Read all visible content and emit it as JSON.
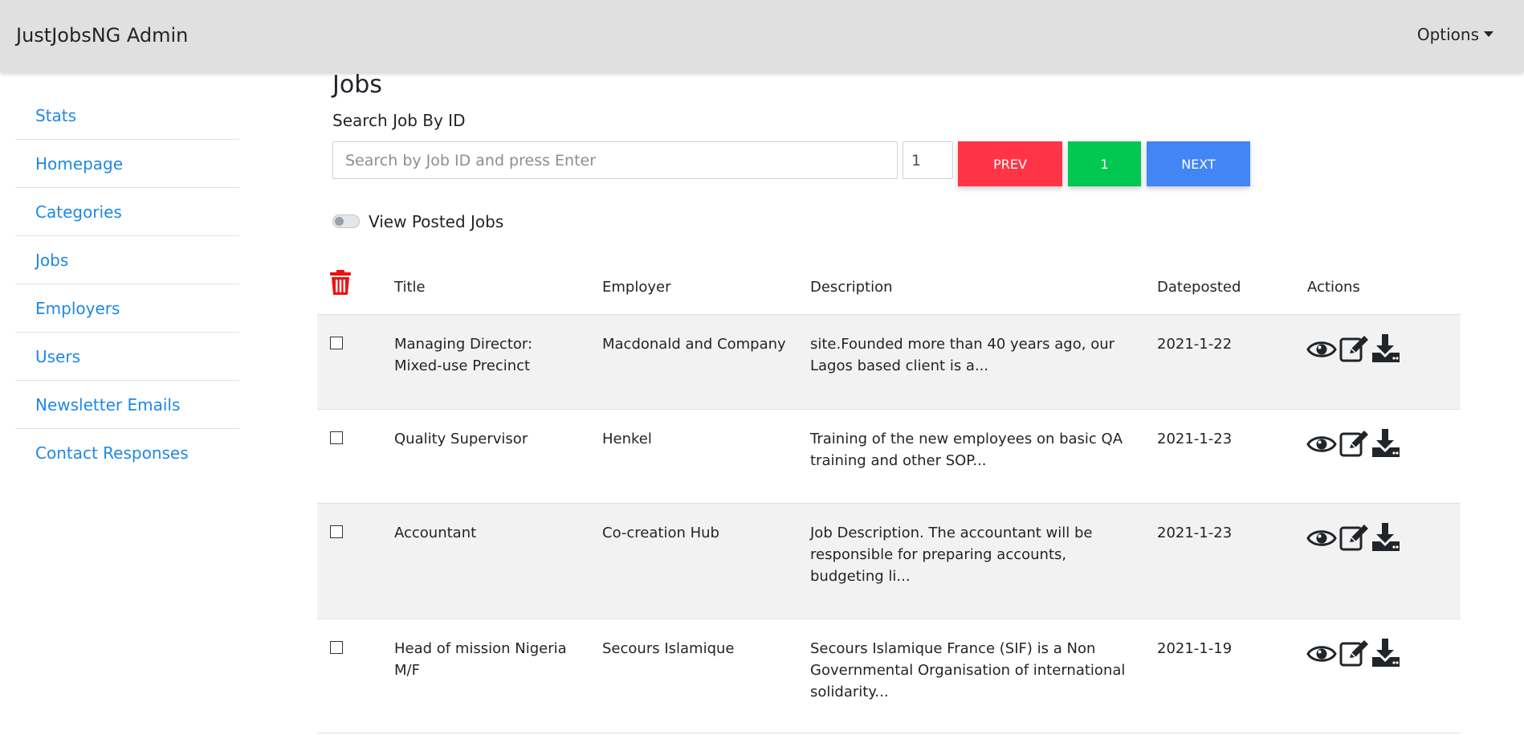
{
  "navbar": {
    "brand": "JustJobsNG Admin",
    "options_label": "Options"
  },
  "sidebar": {
    "items": [
      {
        "label": "Stats"
      },
      {
        "label": "Homepage"
      },
      {
        "label": "Categories"
      },
      {
        "label": "Jobs"
      },
      {
        "label": "Employers"
      },
      {
        "label": "Users"
      },
      {
        "label": "Newsletter Emails"
      },
      {
        "label": "Contact Responses"
      }
    ]
  },
  "main": {
    "title": "Jobs",
    "search_label": "Search Job By ID",
    "search_placeholder": "Search by Job ID and press Enter",
    "page_value": "1",
    "prev_label": "PREV",
    "current_page": "1",
    "next_label": "NEXT",
    "toggle_label": "View Posted Jobs",
    "toggle_on": false
  },
  "table": {
    "headers": {
      "title": "Title",
      "employer": "Employer",
      "description": "Description",
      "dateposted": "Dateposted",
      "actions": "Actions"
    },
    "rows": [
      {
        "title": "Managing Director: Mixed-use Precinct",
        "employer": "Macdonald and Company",
        "description": "site.Founded more than 40 years ago, our Lagos based client is a...",
        "dateposted": "2021-1-22"
      },
      {
        "title": "Quality Supervisor",
        "employer": "Henkel",
        "description": "Training of the new employees on basic QA training and other SOP...",
        "dateposted": "2021-1-23"
      },
      {
        "title": "Accountant",
        "employer": "Co-creation Hub",
        "description": "Job Description. The accountant will be responsible for preparing accounts, budgeting li...",
        "dateposted": "2021-1-23"
      },
      {
        "title": "Head of mission Nigeria M/F",
        "employer": "Secours Islamique",
        "description": "Secours Islamique France (SIF) is a Non Governmental Organisation of international solidarity...",
        "dateposted": "2021-1-19"
      }
    ]
  },
  "colors": {
    "prev": "#ff3547",
    "current": "#00c851",
    "next": "#4285f4",
    "link": "#1e88e5",
    "trash": "#ee1111",
    "stripe": "#f2f2f2"
  },
  "icons": {
    "delete": "trash-icon",
    "view": "eye-icon",
    "edit": "edit-icon",
    "download": "download-icon",
    "options": "caret-down-icon"
  }
}
